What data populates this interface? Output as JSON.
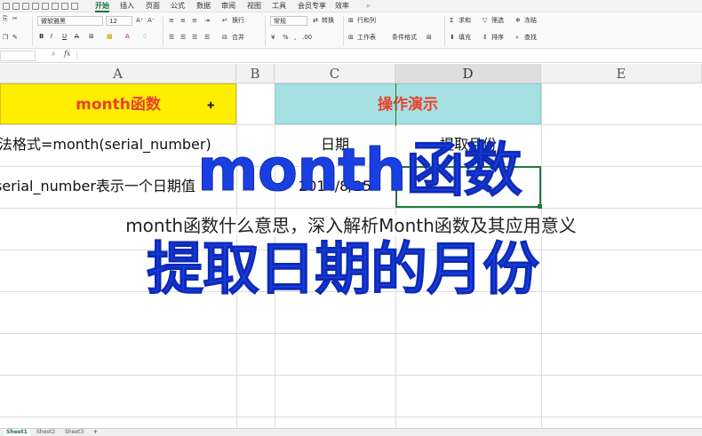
{
  "menu": {
    "items": [
      "开始",
      "插入",
      "页面",
      "公式",
      "数据",
      "审阅",
      "视图",
      "工具",
      "会员专享",
      "效率"
    ],
    "active": "开始"
  },
  "ribbon": {
    "font_name": "微软雅黑",
    "font_size": "12",
    "wrap": "换行",
    "number_format": "常规",
    "convert": "转换",
    "rows_cols": "行和列",
    "worksheet": "工作表",
    "cond_format": "条件格式",
    "merge": "合并",
    "fill": "填充",
    "sort": "排序",
    "filter": "筛选",
    "freeze": "冻结",
    "find": "查找",
    "sum": "求和"
  },
  "formula_bar": {
    "fx": "fx"
  },
  "columns": [
    "A",
    "B",
    "C",
    "D",
    "E"
  ],
  "cells": {
    "a1": "month函数",
    "c1": "操作演示",
    "a2": "语法格式=month(serial_number)",
    "c2": "日期",
    "d2": "提取月份",
    "a3": "serial_number表示一个日期值",
    "c3": "2014/8/25"
  },
  "overlay": {
    "line1": "month函数",
    "line2": "提取日期的月份"
  },
  "caption": "month函数什么意思，深入解析Month函数及其应用意义",
  "sheets": [
    "Sheet1",
    "Sheet2",
    "Sheet3"
  ],
  "colors": {
    "header_yellow": "#ffee00",
    "header_teal": "#a6e0e3",
    "header_text_red": "#e8412c",
    "overlay_blue": "#1a3fe0",
    "selection_green": "#1f7a3a"
  }
}
